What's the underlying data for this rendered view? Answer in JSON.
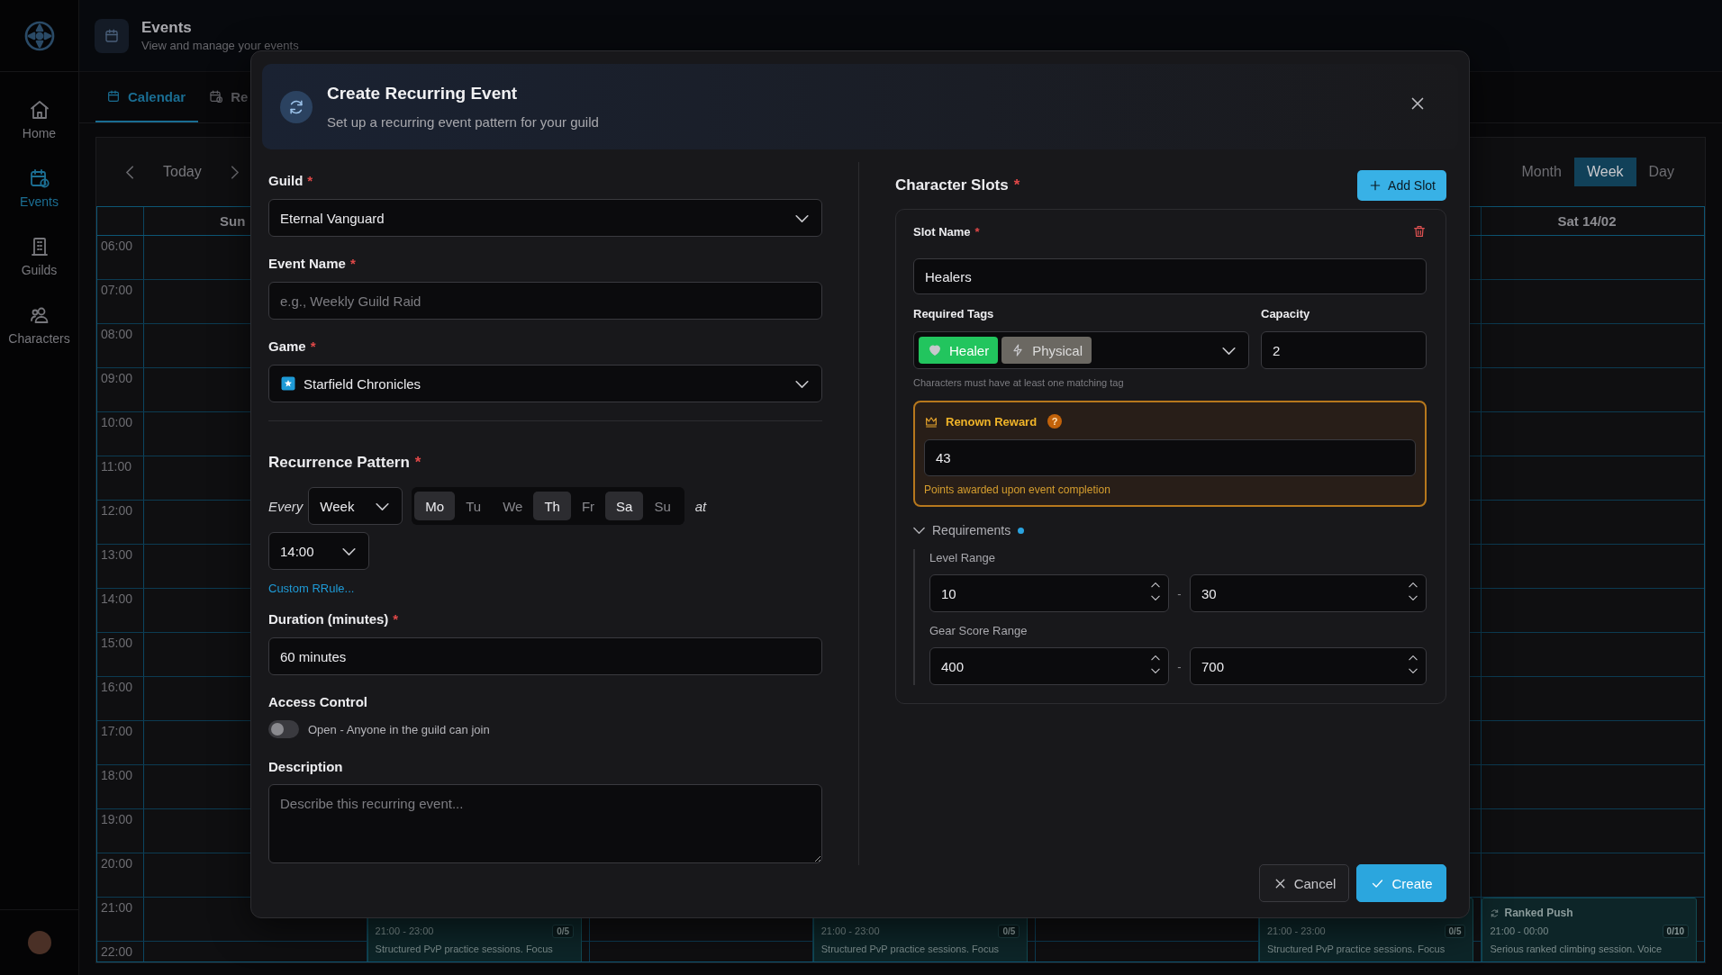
{
  "sidebar": {
    "items": [
      {
        "label": "Home",
        "selected": false
      },
      {
        "label": "Events",
        "selected": true
      },
      {
        "label": "Guilds",
        "selected": false
      },
      {
        "label": "Characters",
        "selected": false
      }
    ]
  },
  "header": {
    "title": "Events",
    "subtitle": "View and manage your events"
  },
  "tabs": [
    {
      "label": "Calendar",
      "selected": true
    },
    {
      "label": "Re",
      "selected": false
    }
  ],
  "calendar": {
    "today": "Today",
    "views": [
      {
        "label": "Month",
        "selected": false
      },
      {
        "label": "Week",
        "selected": true
      },
      {
        "label": "Day",
        "selected": false
      }
    ],
    "columns": [
      {
        "label": "Sun"
      },
      null,
      null,
      null,
      null,
      null,
      {
        "label": "Sat 14/02"
      }
    ],
    "rows": [
      {
        "time": "06:00"
      },
      {
        "time": "07:00"
      },
      {
        "time": "08:00"
      },
      {
        "time": "09:00"
      },
      {
        "time": "10:00"
      },
      {
        "time": "11:00"
      },
      {
        "time": "12:00"
      },
      {
        "time": "13:00"
      },
      {
        "time": "14:00"
      },
      {
        "time": "15:00"
      },
      {
        "time": "16:00"
      },
      {
        "time": "17:00"
      },
      {
        "time": "18:00"
      },
      {
        "time": "19:00"
      },
      {
        "time": "20:00"
      },
      {
        "time": "21:00",
        "cells": [
          null,
          {
            "time": "21:00 - 23:00",
            "count": "0/5",
            "description": "Structured PvP practice sessions. Focus"
          },
          null,
          {
            "time": "21:00 - 23:00",
            "count": "0/5",
            "description": "Structured PvP practice sessions. Focus"
          },
          null,
          {
            "time": "21:00 - 23:00",
            "count": "0/5",
            "description": "Structured PvP practice sessions. Focus"
          },
          {
            "title": "Ranked Push",
            "time": "21:00 - 00:00",
            "count": "0/10",
            "description": "Serious ranked climbing session. Voice"
          }
        ]
      },
      {
        "time": "22:00"
      }
    ]
  },
  "dialog": {
    "title": "Create Recurring Event",
    "subtitle": "Set up a recurring event pattern for your guild",
    "guild": {
      "label": "Guild",
      "required": "*",
      "value": "Eternal Vanguard"
    },
    "event_name": {
      "label": "Event Name",
      "required": "*",
      "placeholder": "e.g., Weekly Guild Raid"
    },
    "game": {
      "label": "Game",
      "required": "*",
      "value": "Starfield Chronicles"
    },
    "recurrence": {
      "label": "Recurrence Pattern",
      "required": "*",
      "every_label": "Every",
      "frequency": "Week",
      "at_label": "at",
      "time": "14:00",
      "custom_link": "Custom RRule...",
      "days": [
        {
          "label": "Mo",
          "selected": true
        },
        {
          "label": "Tu",
          "selected": false
        },
        {
          "label": "We",
          "selected": false
        },
        {
          "label": "Th",
          "selected": true
        },
        {
          "label": "Fr",
          "selected": false
        },
        {
          "label": "Sa",
          "selected": true
        },
        {
          "label": "Su",
          "selected": false
        }
      ]
    },
    "duration": {
      "label": "Duration (minutes)",
      "required": "*",
      "value": "60 minutes"
    },
    "access": {
      "label": "Access Control",
      "on": false,
      "text": "Open - Anyone in the guild can join"
    },
    "description": {
      "label": "Description",
      "placeholder": "Describe this recurring event..."
    },
    "slots": {
      "label": "Character Slots",
      "required": "*",
      "add_button": "Add Slot",
      "items": [
        {
          "name_label": "Slot Name",
          "name_required": "*",
          "name": "Healers",
          "tags_label": "Required Tags",
          "tags": [
            {
              "label": "Healer",
              "kind": "healing",
              "color": "#22c55e"
            },
            {
              "label": "Physical",
              "kind": "physical",
              "color": "#6b6862"
            }
          ],
          "tags_hint": "Characters must have at least one matching tag",
          "capacity_label": "Capacity",
          "capacity": "2",
          "renown": {
            "label": "Renown Reward",
            "help": "?",
            "value": "43",
            "hint": "Points awarded upon event completion"
          },
          "requirements": {
            "label": "Requirements",
            "expanded": true,
            "has_values": true,
            "ranges": [
              {
                "label": "Level Range",
                "min": "10",
                "separator": "-",
                "max": "30"
              },
              {
                "label": "Gear Score Range",
                "min": "400",
                "separator": "-",
                "max": "700"
              }
            ]
          }
        }
      ]
    },
    "buttons": [
      {
        "label": "Cancel",
        "kind": "secondary"
      },
      {
        "label": "Create",
        "kind": "primary"
      }
    ]
  }
}
